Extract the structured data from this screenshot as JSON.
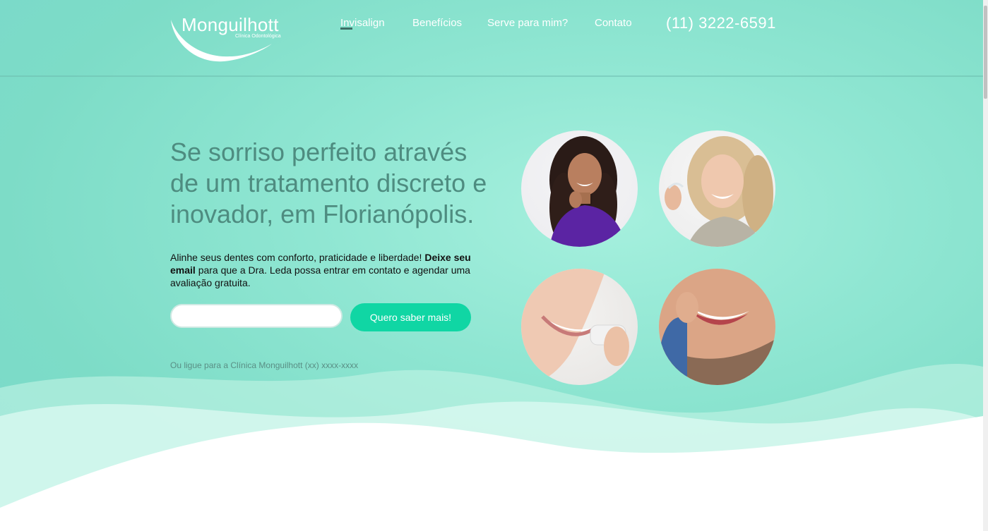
{
  "logo": {
    "name": "Monguilhott",
    "subtitle": "Clínica Odontológica"
  },
  "nav": {
    "items": [
      {
        "label": "Invisalign"
      },
      {
        "label": "Benefícios"
      },
      {
        "label": "Serve para mim?"
      },
      {
        "label": "Contato"
      }
    ],
    "phone": "(11) 3222-6591"
  },
  "hero": {
    "headline": "Se sorriso perfeito através de um tratamento discreto e inovador, em Florianópolis.",
    "sub_part1": "Alinhe seus dentes com conforto, praticidade e liberdade! ",
    "sub_bold": "Deixe seu email",
    "sub_part2": " para que a Dra. Leda possa entrar em contato e agendar uma avaliação gratuita.",
    "email_value": "",
    "cta_label": "Quero saber mais!",
    "call_line": "Ou ligue para a Clínica Monguilhott (xx) xxxx-xxxx"
  },
  "colors": {
    "hero_bg": "#8fe6d2",
    "headline": "#4e8c80",
    "cta": "#10d6a4",
    "nav_text": "#ffffff"
  }
}
